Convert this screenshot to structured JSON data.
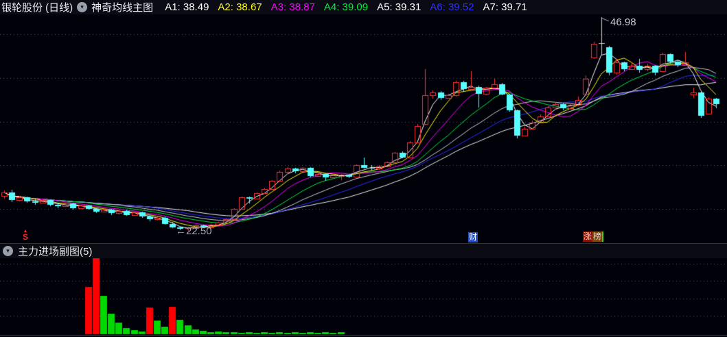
{
  "header": {
    "stock_title": "银轮股份 (日线)",
    "indicator_name": "神奇均线主图",
    "collapse_icon": "▾",
    "values": [
      {
        "text": "A1: 38.49",
        "style": "color:#ffffff"
      },
      {
        "text": "A2: 38.67",
        "style": "color:#ffff00"
      },
      {
        "text": "A3: 38.87",
        "style": "color:#ff00ff"
      },
      {
        "text": "A4: 39.09",
        "style": "color:#00f03c"
      },
      {
        "text": "A5: 39.31",
        "style": "color:#ffffff"
      },
      {
        "text": "A6: 39.52",
        "style": "color:#2e2eff"
      },
      {
        "text": "A7: 39.71",
        "style": "color:#ffffff"
      }
    ]
  },
  "sub_header": {
    "title": "主力进场副图(5)",
    "collapse_icon": "▾"
  },
  "annotations": {
    "high_label": "46.98",
    "low_label": "←22.50"
  },
  "markers": {
    "signal": {
      "arrow": "▲",
      "symbol": "S",
      "style": "color:#ff2424"
    },
    "cai": {
      "text": "财",
      "style": "background:#1d4cd0"
    },
    "zhang_char1": {
      "text": "涨",
      "style": "background:#8c1202"
    },
    "zhang_char2": {
      "text": "榜",
      "style": "background:#7d4510;border-right:2px solid #2fd52f"
    }
  },
  "chart_data": {
    "type": "candlestick",
    "title": "银轮股份 日线 神奇均线主图",
    "price_gridlines": [
      45,
      40,
      35,
      30,
      25
    ],
    "y_axis_range": [
      21.0,
      47.3
    ],
    "high_point": {
      "index": 78,
      "price": 46.98
    },
    "low_point": {
      "index": 24,
      "price": 22.5
    },
    "candle_up_color": "#ff3232",
    "candle_down_color": "#55ffff",
    "special_candle": {
      "index": 78,
      "color": "#cccccc"
    },
    "ma_periods": [
      3,
      5,
      8,
      12,
      16,
      20,
      25
    ],
    "ma_colors": [
      "#ffffff",
      "#ffff00",
      "#ff00ff",
      "#00f03c",
      "#d0d0d0",
      "#2e2eff",
      "#f2f2f2"
    ],
    "candles": [
      [
        26.5,
        27.1,
        26.2,
        26.9
      ],
      [
        26.9,
        27.2,
        25.8,
        26.0
      ],
      [
        26.0,
        26.5,
        25.9,
        26.3
      ],
      [
        26.3,
        26.4,
        25.7,
        25.9
      ],
      [
        25.9,
        26.1,
        25.5,
        25.7
      ],
      [
        25.7,
        26.1,
        25.6,
        26.0
      ],
      [
        26.0,
        26.1,
        25.3,
        25.5
      ],
      [
        25.5,
        25.7,
        25.1,
        25.3
      ],
      [
        25.3,
        25.7,
        25.2,
        25.6
      ],
      [
        25.6,
        25.7,
        24.9,
        25.1
      ],
      [
        25.1,
        25.5,
        25.0,
        25.4
      ],
      [
        25.4,
        25.5,
        24.9,
        25.0
      ],
      [
        25.0,
        25.1,
        24.5,
        24.7
      ],
      [
        24.7,
        25.0,
        24.6,
        24.9
      ],
      [
        24.9,
        25.0,
        24.3,
        24.5
      ],
      [
        24.5,
        24.9,
        24.4,
        24.8
      ],
      [
        24.8,
        24.9,
        24.2,
        24.3
      ],
      [
        24.3,
        24.7,
        24.2,
        24.6
      ],
      [
        24.6,
        24.7,
        24.0,
        24.1
      ],
      [
        24.1,
        24.3,
        23.6,
        23.8
      ],
      [
        23.8,
        24.1,
        23.7,
        24.0
      ],
      [
        24.0,
        24.1,
        23.2,
        23.3
      ],
      [
        23.3,
        23.5,
        22.8,
        22.9
      ],
      [
        22.9,
        23.0,
        22.6,
        22.7
      ],
      [
        22.7,
        22.9,
        22.5,
        22.8
      ],
      [
        22.8,
        23.2,
        22.7,
        23.1
      ],
      [
        23.1,
        23.2,
        22.8,
        22.9
      ],
      [
        22.9,
        23.3,
        22.8,
        23.2
      ],
      [
        23.2,
        23.5,
        23.1,
        23.4
      ],
      [
        23.4,
        23.9,
        23.3,
        23.8
      ],
      [
        23.8,
        25.1,
        23.7,
        25.0
      ],
      [
        25.0,
        26.4,
        24.9,
        26.3
      ],
      [
        26.3,
        26.4,
        25.6,
        26.2
      ],
      [
        26.2,
        26.9,
        26.1,
        26.8
      ],
      [
        26.8,
        27.4,
        26.7,
        27.3
      ],
      [
        27.3,
        28.3,
        27.2,
        28.2
      ],
      [
        28.2,
        29.4,
        28.1,
        29.2
      ],
      [
        29.2,
        29.8,
        29.0,
        29.6
      ],
      [
        29.6,
        29.7,
        29.1,
        29.3
      ],
      [
        29.3,
        29.8,
        29.2,
        29.7
      ],
      [
        29.7,
        29.8,
        28.6,
        28.8
      ],
      [
        28.8,
        29.2,
        28.7,
        29.0
      ],
      [
        29.0,
        29.1,
        28.2,
        28.6
      ],
      [
        28.6,
        29.0,
        28.5,
        28.9
      ],
      [
        28.8,
        29.0,
        28.3,
        28.9
      ],
      [
        28.9,
        29.0,
        28.5,
        28.7
      ],
      [
        28.7,
        30.1,
        28.6,
        30.0
      ],
      [
        30.0,
        30.9,
        29.6,
        29.7
      ],
      [
        29.7,
        30.0,
        29.4,
        29.6
      ],
      [
        29.6,
        30.0,
        29.5,
        29.9
      ],
      [
        29.9,
        30.4,
        29.8,
        30.3
      ],
      [
        30.3,
        31.5,
        30.2,
        31.4
      ],
      [
        31.4,
        31.6,
        30.8,
        30.9
      ],
      [
        30.9,
        32.8,
        30.8,
        32.6
      ],
      [
        32.6,
        34.7,
        32.5,
        34.5
      ],
      [
        34.7,
        41.0,
        34.6,
        38.0
      ],
      [
        38.0,
        38.6,
        37.6,
        38.3
      ],
      [
        38.3,
        38.5,
        37.5,
        37.7
      ],
      [
        37.7,
        38.2,
        37.6,
        38.0
      ],
      [
        38.0,
        39.7,
        37.9,
        39.5
      ],
      [
        39.5,
        39.7,
        38.5,
        38.7
      ],
      [
        38.7,
        40.8,
        38.6,
        39.0
      ],
      [
        39.0,
        39.1,
        36.6,
        38.2
      ],
      [
        38.2,
        39.0,
        38.0,
        38.9
      ],
      [
        38.9,
        39.9,
        38.8,
        39.3
      ],
      [
        39.3,
        39.4,
        38.0,
        38.1
      ],
      [
        38.1,
        38.2,
        36.1,
        36.3
      ],
      [
        36.3,
        36.4,
        33.1,
        33.4
      ],
      [
        33.4,
        34.4,
        33.3,
        34.2
      ],
      [
        34.2,
        35.1,
        34.1,
        34.9
      ],
      [
        34.9,
        35.8,
        34.8,
        35.6
      ],
      [
        35.6,
        36.8,
        35.5,
        36.6
      ],
      [
        36.6,
        37.2,
        36.4,
        37.0
      ],
      [
        37.0,
        37.1,
        36.3,
        36.5
      ],
      [
        36.5,
        37.1,
        36.4,
        36.9
      ],
      [
        36.9,
        37.9,
        36.8,
        37.5
      ],
      [
        38.2,
        40.3,
        38.1,
        39.9
      ],
      [
        42.3,
        44.1,
        42.2,
        43.9
      ],
      [
        43.9,
        46.98,
        42.6,
        44.0
      ],
      [
        43.5,
        43.7,
        40.3,
        40.6
      ],
      [
        40.6,
        42.2,
        40.4,
        41.8
      ],
      [
        41.8,
        41.9,
        40.8,
        41.0
      ],
      [
        41.0,
        41.7,
        40.9,
        41.4
      ],
      [
        41.4,
        42.2,
        40.6,
        40.9
      ],
      [
        41.0,
        41.6,
        40.8,
        41.4
      ],
      [
        41.4,
        41.5,
        40.3,
        40.6
      ],
      [
        40.8,
        42.9,
        40.7,
        42.7
      ],
      [
        42.7,
        42.8,
        41.6,
        41.9
      ],
      [
        41.9,
        42.0,
        41.2,
        41.5
      ],
      [
        41.5,
        43.0,
        41.4,
        41.8
      ],
      [
        38.1,
        38.9,
        37.7,
        38.3
      ],
      [
        38.3,
        38.4,
        35.4,
        35.7
      ],
      [
        35.9,
        37.8,
        35.8,
        37.6
      ],
      [
        37.6,
        37.7,
        36.5,
        37.0
      ]
    ],
    "sub_chart": {
      "type": "bar",
      "title": "主力进场副图(5)",
      "up_color": "#ff0000",
      "down_color": "#00d800",
      "bars": [
        [
          11,
          "r",
          69
        ],
        [
          12,
          "r",
          111
        ],
        [
          13,
          "g",
          56
        ],
        [
          14,
          "g",
          30
        ],
        [
          15,
          "g",
          17
        ],
        [
          16,
          "g",
          9
        ],
        [
          17,
          "g",
          6
        ],
        [
          18,
          "g",
          4
        ],
        [
          19,
          "r",
          39
        ],
        [
          20,
          "g",
          20
        ],
        [
          21,
          "g",
          11
        ],
        [
          22,
          "r",
          40
        ],
        [
          23,
          "g",
          21
        ],
        [
          24,
          "g",
          13
        ],
        [
          25,
          "g",
          7
        ],
        [
          26,
          "g",
          5
        ],
        [
          27,
          "g",
          3
        ],
        [
          28,
          "g",
          4
        ],
        [
          29,
          "g",
          3
        ],
        [
          30,
          "g",
          3
        ],
        [
          31,
          "g",
          2
        ],
        [
          32,
          "g",
          3
        ],
        [
          33,
          "g",
          2
        ],
        [
          34,
          "g",
          3
        ],
        [
          35,
          "g",
          2
        ],
        [
          36,
          "g",
          3
        ],
        [
          37,
          "g",
          2
        ],
        [
          38,
          "g",
          3
        ],
        [
          39,
          "g",
          2
        ],
        [
          40,
          "g",
          3
        ],
        [
          41,
          "g",
          2
        ],
        [
          42,
          "g",
          3
        ],
        [
          43,
          "g",
          2
        ],
        [
          44,
          "g",
          3
        ]
      ]
    }
  }
}
